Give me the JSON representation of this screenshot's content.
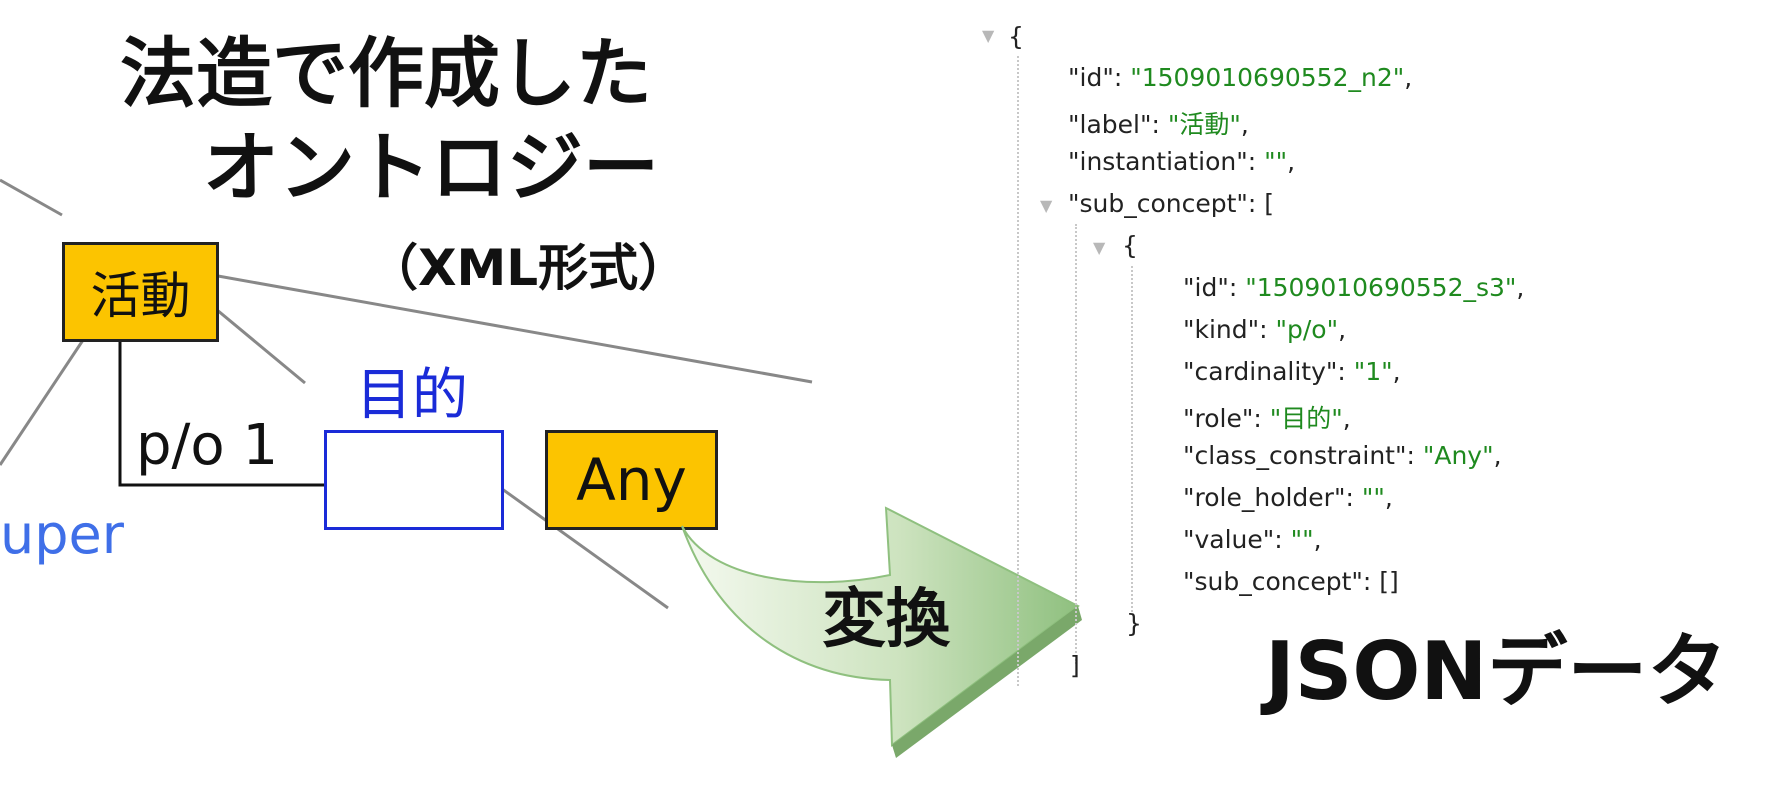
{
  "title": {
    "line1": "法造で作成した",
    "line2": "オントロジー",
    "line3": "（XML形式）"
  },
  "diagram": {
    "concept_label": "活動",
    "relation_label": "p/o 1",
    "role_label": "目的",
    "class_constraint_label": "Any",
    "super_fragment": "uper"
  },
  "arrow_label": "変換",
  "json_title": "JSONデータ",
  "json_view": {
    "open_brace": "{",
    "id_key": "\"id\"",
    "id_value": "\"1509010690552_n2\"",
    "label_key": "\"label\"",
    "label_value": "\"活動\"",
    "instantiation_key": "\"instantiation\"",
    "instantiation_value": "\"\"",
    "sub_concept_key": "\"sub_concept\"",
    "open_bracket": "[",
    "inner_open_brace": "{",
    "inner": {
      "id_key": "\"id\"",
      "id_value": "\"1509010690552_s3\"",
      "kind_key": "\"kind\"",
      "kind_value": "\"p/o\"",
      "cardinality_key": "\"cardinality\"",
      "cardinality_value": "\"1\"",
      "role_key": "\"role\"",
      "role_value": "\"目的\"",
      "class_constraint_key": "\"class_constraint\"",
      "class_constraint_value": "\"Any\"",
      "role_holder_key": "\"role_holder\"",
      "role_holder_value": "\"\"",
      "value_key": "\"value\"",
      "value_value": "\"\"",
      "sub_concept_key": "\"sub_concept\"",
      "sub_concept_value": "[]"
    },
    "inner_close_brace": "}",
    "close_bracket": "]"
  },
  "colors": {
    "concept_fill": "#fcc400",
    "role_border": "#1a2bd8",
    "super_text": "#3f6fe8",
    "json_string": "#1f8a1f",
    "arrow": "#8fc07f"
  }
}
